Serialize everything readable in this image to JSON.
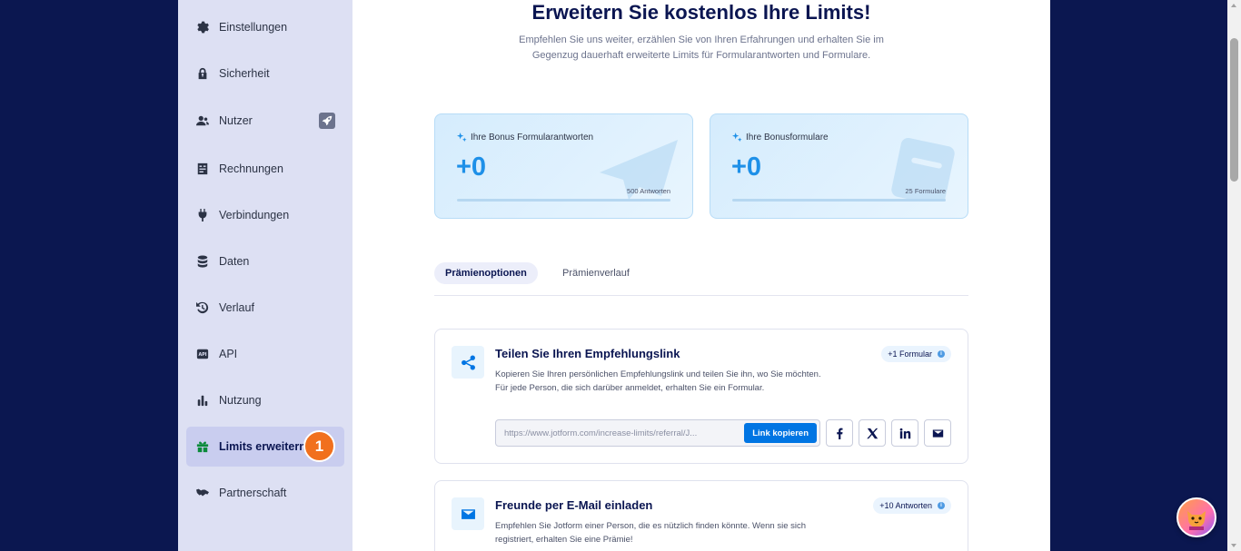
{
  "sidebar": {
    "items": [
      {
        "label": "Einstellungen",
        "icon": "gear-icon"
      },
      {
        "label": "Sicherheit",
        "icon": "lock-icon"
      },
      {
        "label": "Nutzer",
        "icon": "users-icon"
      },
      {
        "label": "Rechnungen",
        "icon": "invoice-icon"
      },
      {
        "label": "Verbindungen",
        "icon": "plug-icon"
      },
      {
        "label": "Daten",
        "icon": "database-icon"
      },
      {
        "label": "Verlauf",
        "icon": "history-icon"
      },
      {
        "label": "API",
        "icon": "api-icon"
      },
      {
        "label": "Nutzung",
        "icon": "bar-chart-icon"
      },
      {
        "label": "Limits erweitern",
        "icon": "gift-icon",
        "active": true
      },
      {
        "label": "Partnerschaft",
        "icon": "handshake-icon"
      }
    ],
    "step_badge": "1"
  },
  "main": {
    "title": "Erweitern Sie kostenlos Ihre Limits!",
    "subtitle": "Empfehlen Sie uns weiter, erzählen Sie von Ihren Erfahrungen und erhalten Sie im Gegenzug dauerhaft erweiterte Limits für Formularantworten und Formulare.",
    "stats": [
      {
        "label": "Ihre Bonus Formularantworten",
        "value": "+0",
        "caption": "500 Antworten",
        "progress": 0
      },
      {
        "label": "Ihre Bonusformulare",
        "value": "+0",
        "caption": "25 Formulare",
        "progress": 0
      }
    ],
    "tabs": [
      {
        "label": "Prämienoptionen",
        "active": true
      },
      {
        "label": "Prämienverlauf",
        "active": false
      }
    ],
    "options": [
      {
        "title": "Teilen Sie Ihren Empfehlungslink",
        "description": "Kopieren Sie Ihren persönlichen Empfehlungslink und teilen Sie ihn, wo Sie möchten. Für jede Person, die sich darüber anmeldet, erhalten Sie ein Formular.",
        "reward": "+1 Formular",
        "link": "https://www.jotform.com/increase-limits/referral/J...",
        "copy_label": "Link kopieren"
      },
      {
        "title": "Freunde per E-Mail einladen",
        "description": "Empfehlen Sie Jotform einer Person, die es nützlich finden könnte. Wenn sie sich registriert, erhalten Sie eine Prämie!",
        "reward": "+10 Antworten"
      }
    ]
  },
  "colors": {
    "page_bg": "#0b1750",
    "sidebar_bg": "#dde0f3",
    "accent": "#1e90e8",
    "button": "#0075e3",
    "badge": "#f1701d"
  }
}
